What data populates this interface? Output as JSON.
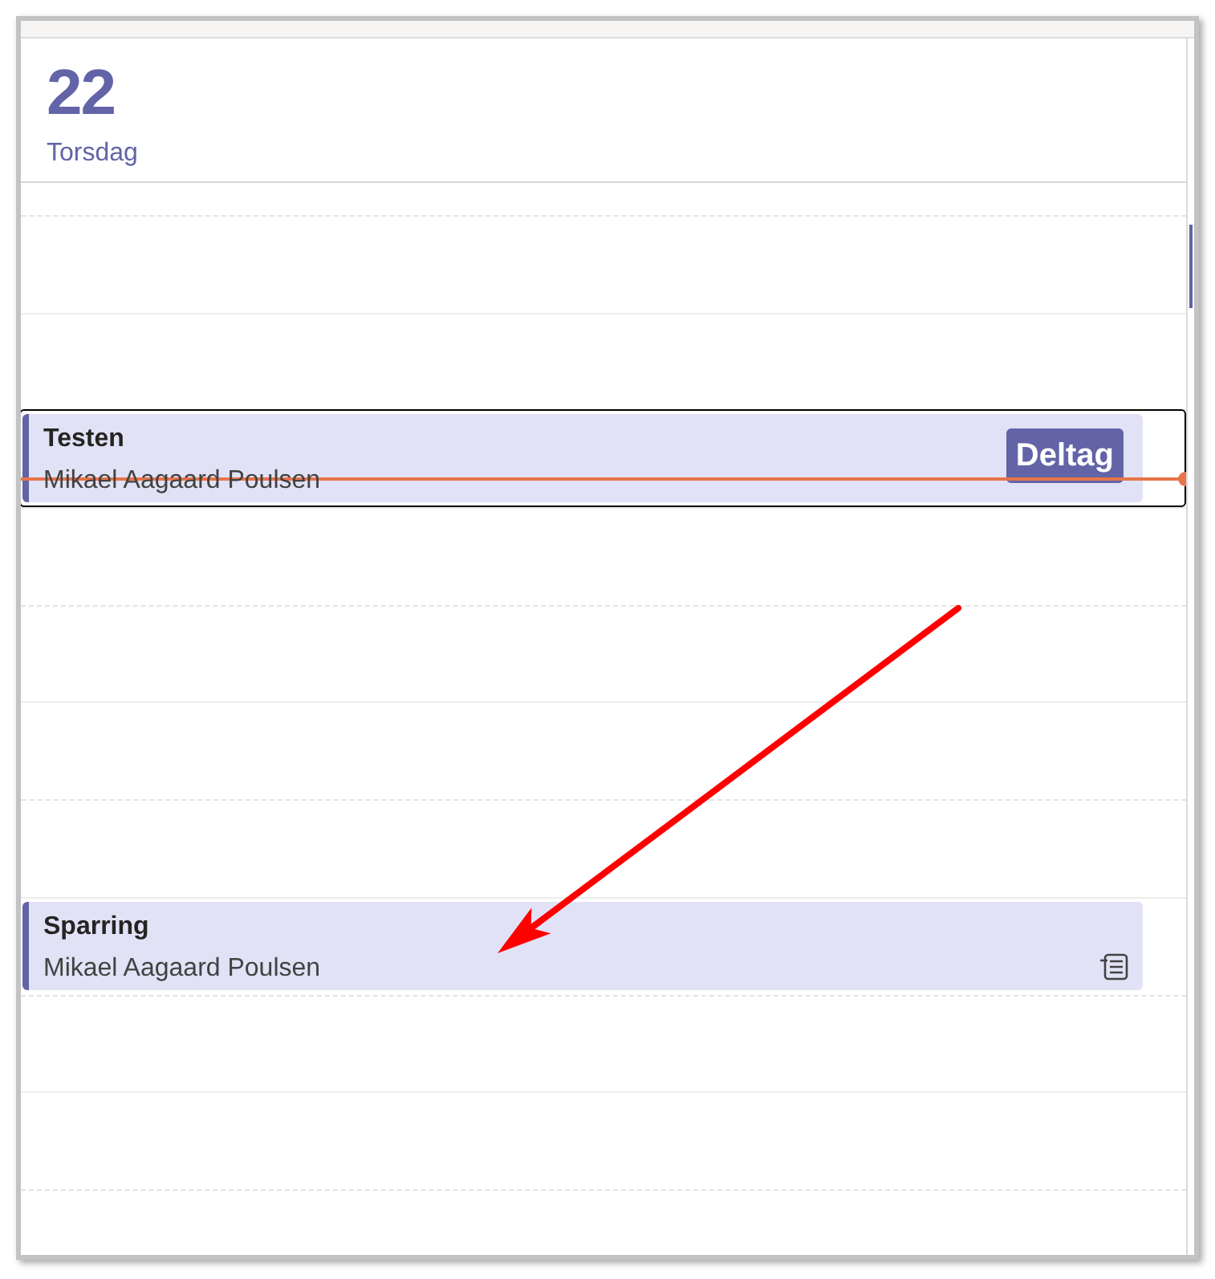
{
  "day": {
    "number": "22",
    "weekday": "Torsdag"
  },
  "now_line": true,
  "events": [
    {
      "kind": "join",
      "title": "Testen",
      "organizer": "Mikael Aagaard Poulsen",
      "action": "Deltag",
      "focused": true
    },
    {
      "kind": "notes",
      "title": "Sparring",
      "organizer": "Mikael Aagaard Poulsen",
      "focused": false
    }
  ]
}
